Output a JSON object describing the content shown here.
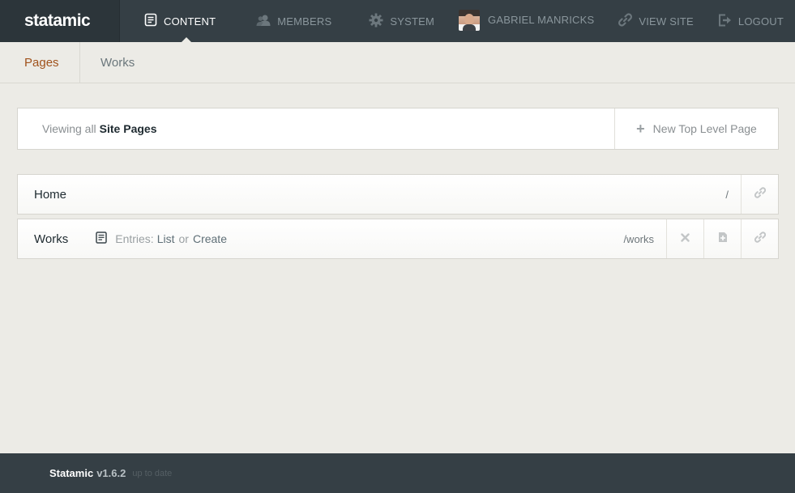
{
  "topbar": {
    "logo": "statamic",
    "nav": {
      "content": "CONTENT",
      "members": "MEMBERS",
      "system": "SYSTEM",
      "user": "GABRIEL MANRICKS",
      "view_site": "VIEW SITE",
      "logout": "LOGOUT"
    }
  },
  "subnav": {
    "tabs": [
      {
        "label": "Pages",
        "active": true
      },
      {
        "label": "Works",
        "active": false
      }
    ]
  },
  "viewbar": {
    "prefix": "Viewing all",
    "scope": "Site Pages",
    "new_page": "New Top Level Page"
  },
  "pages": [
    {
      "title": "Home",
      "url": "/"
    },
    {
      "title": "Works",
      "url": "/works",
      "entries_label": "Entries:",
      "list_label": "List",
      "or_label": "or",
      "create_label": "Create"
    }
  ],
  "footer": {
    "brand": "Statamic",
    "version": "v1.6.2",
    "status": "up to date"
  },
  "colors": {
    "topbar_bg": "#353f45",
    "logo_bg": "#2c353a",
    "page_bg": "#ecebe6",
    "active_tab": "#a0521c"
  },
  "icons": [
    "content-icon",
    "members-icon",
    "system-icon",
    "view-site-icon",
    "logout-icon",
    "plus-icon",
    "link-icon",
    "entries-icon",
    "delete-icon",
    "add-entry-icon"
  ]
}
